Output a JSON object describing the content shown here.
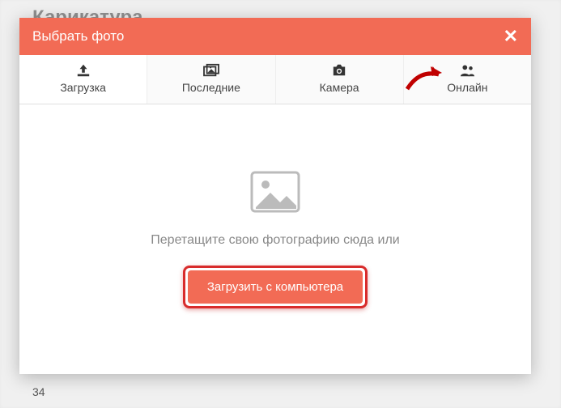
{
  "background": {
    "title_partial": "Карикатура",
    "footer_num": "34"
  },
  "modal": {
    "title": "Выбрать фото",
    "close": "✕",
    "tabs": {
      "upload": "Загрузка",
      "recent": "Последние",
      "camera": "Камера",
      "online": "Онлайн"
    },
    "content": {
      "drag_text": "Перетащите свою фотографию сюда или",
      "upload_button": "Загрузить с компьютера"
    }
  }
}
